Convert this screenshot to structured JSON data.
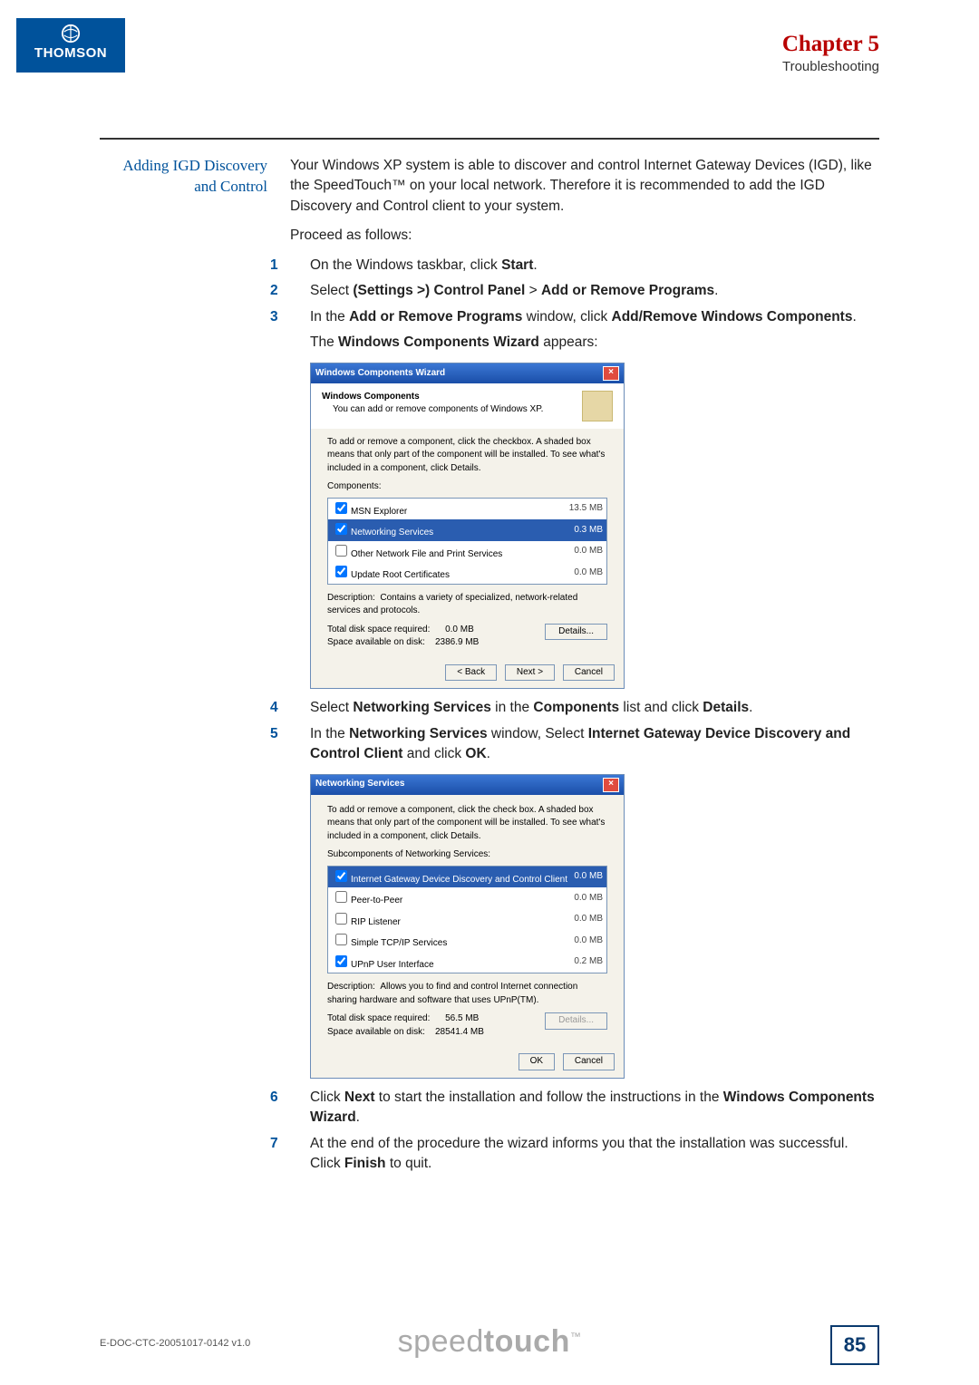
{
  "header": {
    "brand": "THOMSON",
    "chapter": "Chapter 5",
    "subtitle": "Troubleshooting"
  },
  "section": {
    "heading": "Adding IGD Discovery and Control",
    "intro": "Your Windows XP system is able to discover and control Internet Gateway Devices (IGD), like the SpeedTouch™ on your local network. Therefore it is recommended to add the IGD Discovery and Control client to your system.",
    "proceed": "Proceed as follows:",
    "steps": {
      "s1_pre": "On the Windows taskbar, click ",
      "s1_b": "Start",
      "s2_pre": "Select ",
      "s2_b1": "(Settings >) Control Panel",
      "s2_mid": " > ",
      "s2_b2": "Add or Remove Programs",
      "s3_pre": "In the ",
      "s3_b1": "Add or Remove Programs",
      "s3_mid": " window, click ",
      "s3_b2": "Add/Remove Windows Components",
      "s3_after_pre": "The ",
      "s3_after_b": "Windows Components Wizard",
      "s3_after_post": " appears:",
      "s4_pre": "Select ",
      "s4_b1": "Networking Services",
      "s4_mid": " in the ",
      "s4_b2": "Components",
      "s4_mid2": " list and click ",
      "s4_b3": "Details",
      "s5_pre": "In the ",
      "s5_b1": "Networking Services",
      "s5_mid": " window, Select ",
      "s5_b2": "Internet Gateway Device Discovery and Control Client",
      "s5_mid2": " and click ",
      "s5_b3": "OK",
      "s6_pre": "Click ",
      "s6_b1": "Next",
      "s6_mid": " to start the installation and follow the instructions in the ",
      "s6_b2": "Windows Components Wizard",
      "s7_pre": "At the end of the procedure the wizard informs you that the installation was successful. Click ",
      "s7_b": "Finish",
      "s7_post": " to quit."
    }
  },
  "wiz1": {
    "title": "Windows Components Wizard",
    "heading": "Windows Components",
    "sub": "You can add or remove components of Windows XP.",
    "explain": "To add or remove a component, click the checkbox. A shaded box means that only part of the component will be installed. To see what's included in a component, click Details.",
    "comp_label": "Components:",
    "rows": [
      {
        "name": "MSN Explorer",
        "size": "13.5 MB"
      },
      {
        "name": "Networking Services",
        "size": "0.3 MB"
      },
      {
        "name": "Other Network File and Print Services",
        "size": "0.0 MB"
      },
      {
        "name": "Update Root Certificates",
        "size": "0.0 MB"
      }
    ],
    "desc_label": "Description:",
    "desc": "Contains a variety of specialized, network-related services and protocols.",
    "disk_req_lbl": "Total disk space required:",
    "disk_req": "0.0 MB",
    "disk_avail_lbl": "Space available on disk:",
    "disk_avail": "2386.9 MB",
    "details_btn": "Details...",
    "back": "< Back",
    "next": "Next >",
    "cancel": "Cancel"
  },
  "wiz2": {
    "title": "Networking Services",
    "explain": "To add or remove a component, click the check box. A shaded box means that only part of the component will be installed. To see what's included in a component, click Details.",
    "sub_label": "Subcomponents of Networking Services:",
    "rows": [
      {
        "name": "Internet Gateway Device Discovery and Control Client",
        "size": "0.0 MB"
      },
      {
        "name": "Peer-to-Peer",
        "size": "0.0 MB"
      },
      {
        "name": "RIP Listener",
        "size": "0.0 MB"
      },
      {
        "name": "Simple TCP/IP Services",
        "size": "0.0 MB"
      },
      {
        "name": "UPnP User Interface",
        "size": "0.2 MB"
      }
    ],
    "desc_label": "Description:",
    "desc": "Allows you to find and control Internet connection sharing hardware and software that uses UPnP(TM).",
    "disk_req_lbl": "Total disk space required:",
    "disk_req": "56.5 MB",
    "disk_avail_lbl": "Space available on disk:",
    "disk_avail": "28541.4 MB",
    "details_btn": "Details...",
    "ok": "OK",
    "cancel": "Cancel"
  },
  "footer": {
    "docid": "E-DOC-CTC-20051017-0142 v1.0",
    "logo_thin": "speed",
    "logo_bold": "touch",
    "page": "85"
  }
}
